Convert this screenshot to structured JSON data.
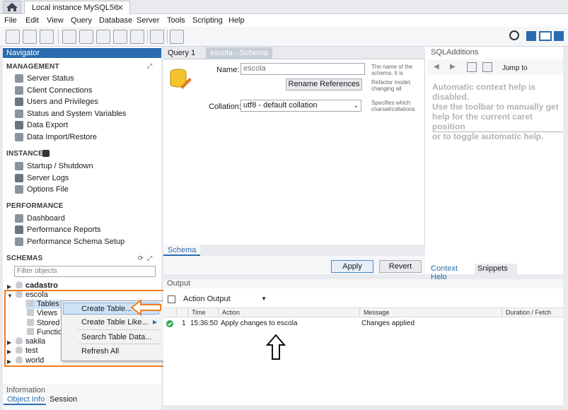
{
  "connection_tab": {
    "title": "Local instance MySQL56",
    "close": "✕"
  },
  "menu": [
    "File",
    "Edit",
    "View",
    "Query",
    "Database",
    "Server",
    "Tools",
    "Scripting",
    "Help"
  ],
  "navigator": {
    "title": "Navigator",
    "management": {
      "title": "MANAGEMENT",
      "items": [
        "Server Status",
        "Client Connections",
        "Users and Privileges",
        "Status and System Variables",
        "Data Export",
        "Data Import/Restore"
      ]
    },
    "instance": {
      "title": "INSTANCE",
      "items": [
        "Startup / Shutdown",
        "Server Logs",
        "Options File"
      ]
    },
    "performance": {
      "title": "PERFORMANCE",
      "items": [
        "Dashboard",
        "Performance Reports",
        "Performance Schema Setup"
      ]
    },
    "schemas": {
      "title": "SCHEMAS",
      "filter_placeholder": "Filter objects",
      "tree": [
        "cadastro",
        "escola",
        "Tables",
        "Views",
        "Stored P",
        "Function",
        "sakila",
        "test",
        "world"
      ]
    }
  },
  "context_menu": [
    "Create Table...",
    "Create Table Like...",
    "Search Table Data...",
    "Refresh All"
  ],
  "info_panel": {
    "title": "Information",
    "tabs": [
      "Object Info",
      "Session"
    ]
  },
  "editor": {
    "tabs": [
      "Query 1",
      "escola - Schema"
    ],
    "name_label": "Name:",
    "name_value": "escola",
    "rename_button": "Rename References",
    "collation_label": "Collation:",
    "collation_value": "utf8 - default collation",
    "name_hint": [
      "The name of the",
      "schema. It is",
      "Refactor model,",
      "changing all"
    ],
    "collation_hint": [
      "Specifies which",
      "charset/collations"
    ],
    "subtab": "Schema",
    "apply_button": "Apply",
    "revert_button": "Revert"
  },
  "sql_additions": {
    "title": "SQLAdditions",
    "jump_to": "Jump to",
    "help_text": [
      "Automatic context help is disabled.",
      "Use the toolbar to manually get",
      "help for the current caret position",
      "or to toggle automatic help."
    ],
    "tabs": [
      "Context Help",
      "Snippets"
    ]
  },
  "output": {
    "title": "Output",
    "selector": "Action Output",
    "columns": [
      "",
      "Time",
      "Action",
      "Message",
      "Duration / Fetch"
    ],
    "rows": [
      {
        "index": "1",
        "time": "15:36:50",
        "action": "Apply changes to escola",
        "message": "Changes applied",
        "duration": ""
      }
    ]
  },
  "colors": {
    "accent": "#2b6cb0",
    "highlight": "#f07b1e",
    "ok": "#2fa84f"
  }
}
